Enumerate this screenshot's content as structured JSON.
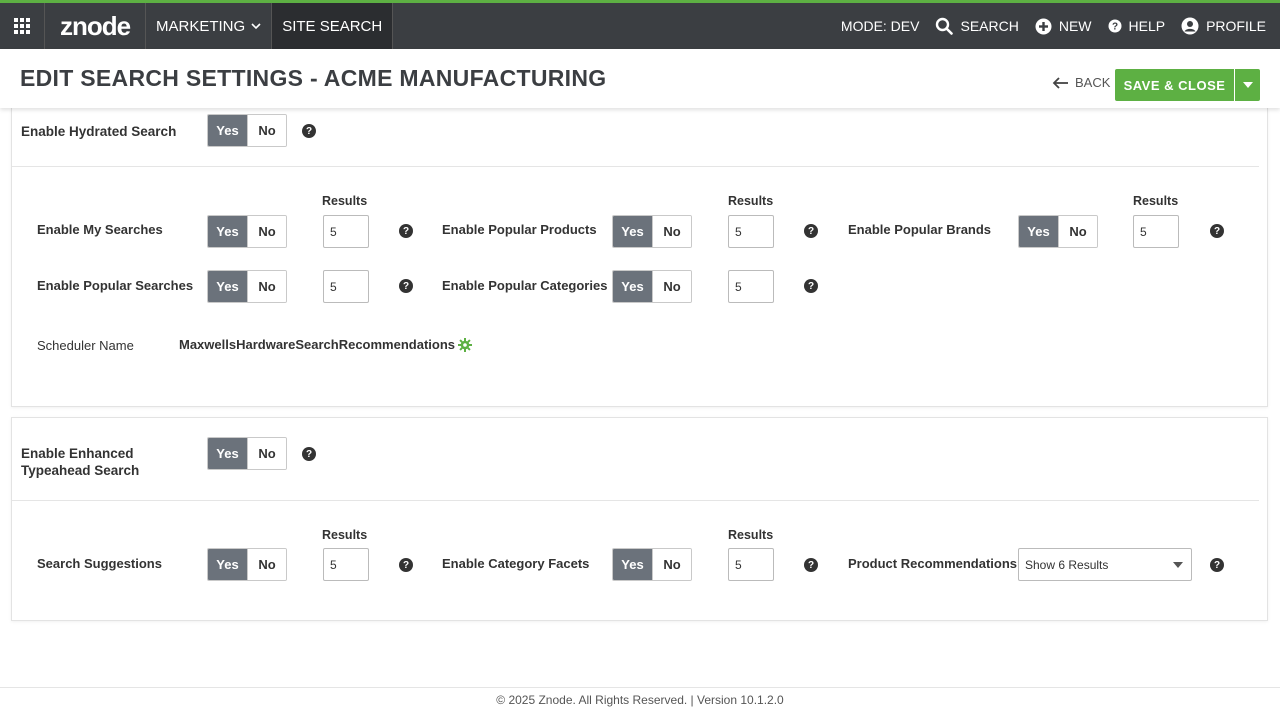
{
  "nav": {
    "logo": "znode",
    "marketing": "MARKETING",
    "site_search": "SITE SEARCH",
    "mode": "MODE: DEV",
    "search": "SEARCH",
    "new": "NEW",
    "help": "HELP",
    "profile": "PROFILE"
  },
  "header": {
    "title": "EDIT SEARCH SETTINGS - ACME MANUFACTURING",
    "back": "BACK",
    "save_close": "SAVE & CLOSE"
  },
  "toggle": {
    "yes": "Yes",
    "no": "No"
  },
  "results_label": "Results",
  "help_glyph": "?",
  "section1": {
    "main_label": "Enable Hydrated Search",
    "items": [
      {
        "label": "Enable My Searches",
        "value": "5"
      },
      {
        "label": "Enable Popular Products",
        "value": "5"
      },
      {
        "label": "Enable Popular Brands",
        "value": "5"
      },
      {
        "label": "Enable Popular Searches",
        "value": "5"
      },
      {
        "label": "Enable Popular Categories",
        "value": "5"
      }
    ],
    "scheduler_label": "Scheduler Name",
    "scheduler_value": "MaxwellsHardwareSearchRecommendations"
  },
  "section2": {
    "main_label_line1": "Enable Enhanced",
    "main_label_line2": "Typeahead Search",
    "items": [
      {
        "label": "Search Suggestions",
        "value": "5"
      },
      {
        "label": "Enable Category Facets",
        "value": "5"
      }
    ],
    "product_rec_label": "Product Recommendations",
    "product_rec_value": "Show 6 Results"
  },
  "footer": "© 2025 Znode. All Rights Reserved. | Version 10.1.2.0",
  "colors": {
    "nav_bg": "#3b3e42",
    "accent_green": "#5db043",
    "toggle_active": "#6b727b"
  }
}
